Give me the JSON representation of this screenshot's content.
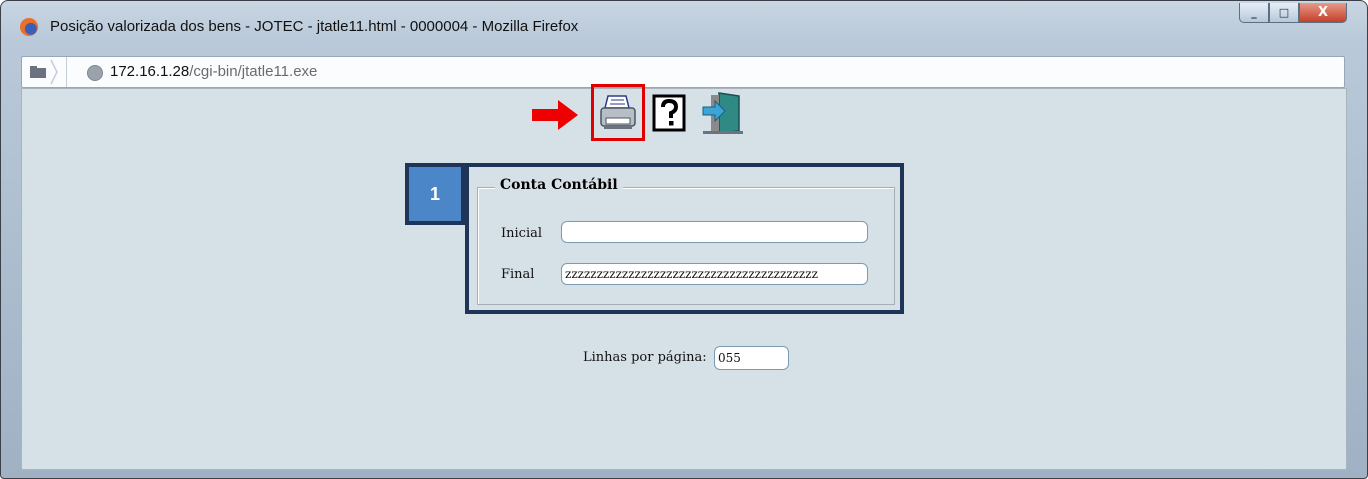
{
  "window": {
    "title": "Posição valorizada dos bens - JOTEC - jtatle11.html - 0000004 - Mozilla Firefox",
    "controls": {
      "minimize": "_",
      "maximize": "□",
      "close": "X"
    }
  },
  "address_bar": {
    "url_host": "172.16.1.28",
    "url_path": "/cgi-bin/jtatle11.exe"
  },
  "toolbar": {
    "icons": [
      "arrow-right-icon",
      "printer-icon",
      "help-icon",
      "exit-door-icon"
    ]
  },
  "callout": {
    "number": "1"
  },
  "form": {
    "section_title": "Conta Contábil",
    "inicial_label": "Inicial",
    "inicial_value": "",
    "final_label": "Final",
    "final_value": "zzzzzzzzzzzzzzzzzzzzzzzzzzzzzzzzzzzzzzzz",
    "lines_label": "Linhas por página:",
    "lines_value": "055"
  },
  "colors": {
    "highlight_red": "#e00000",
    "callout_blue": "#4a86c8",
    "frame_navy": "#1f3558",
    "page_background": "#d6e0e7"
  }
}
